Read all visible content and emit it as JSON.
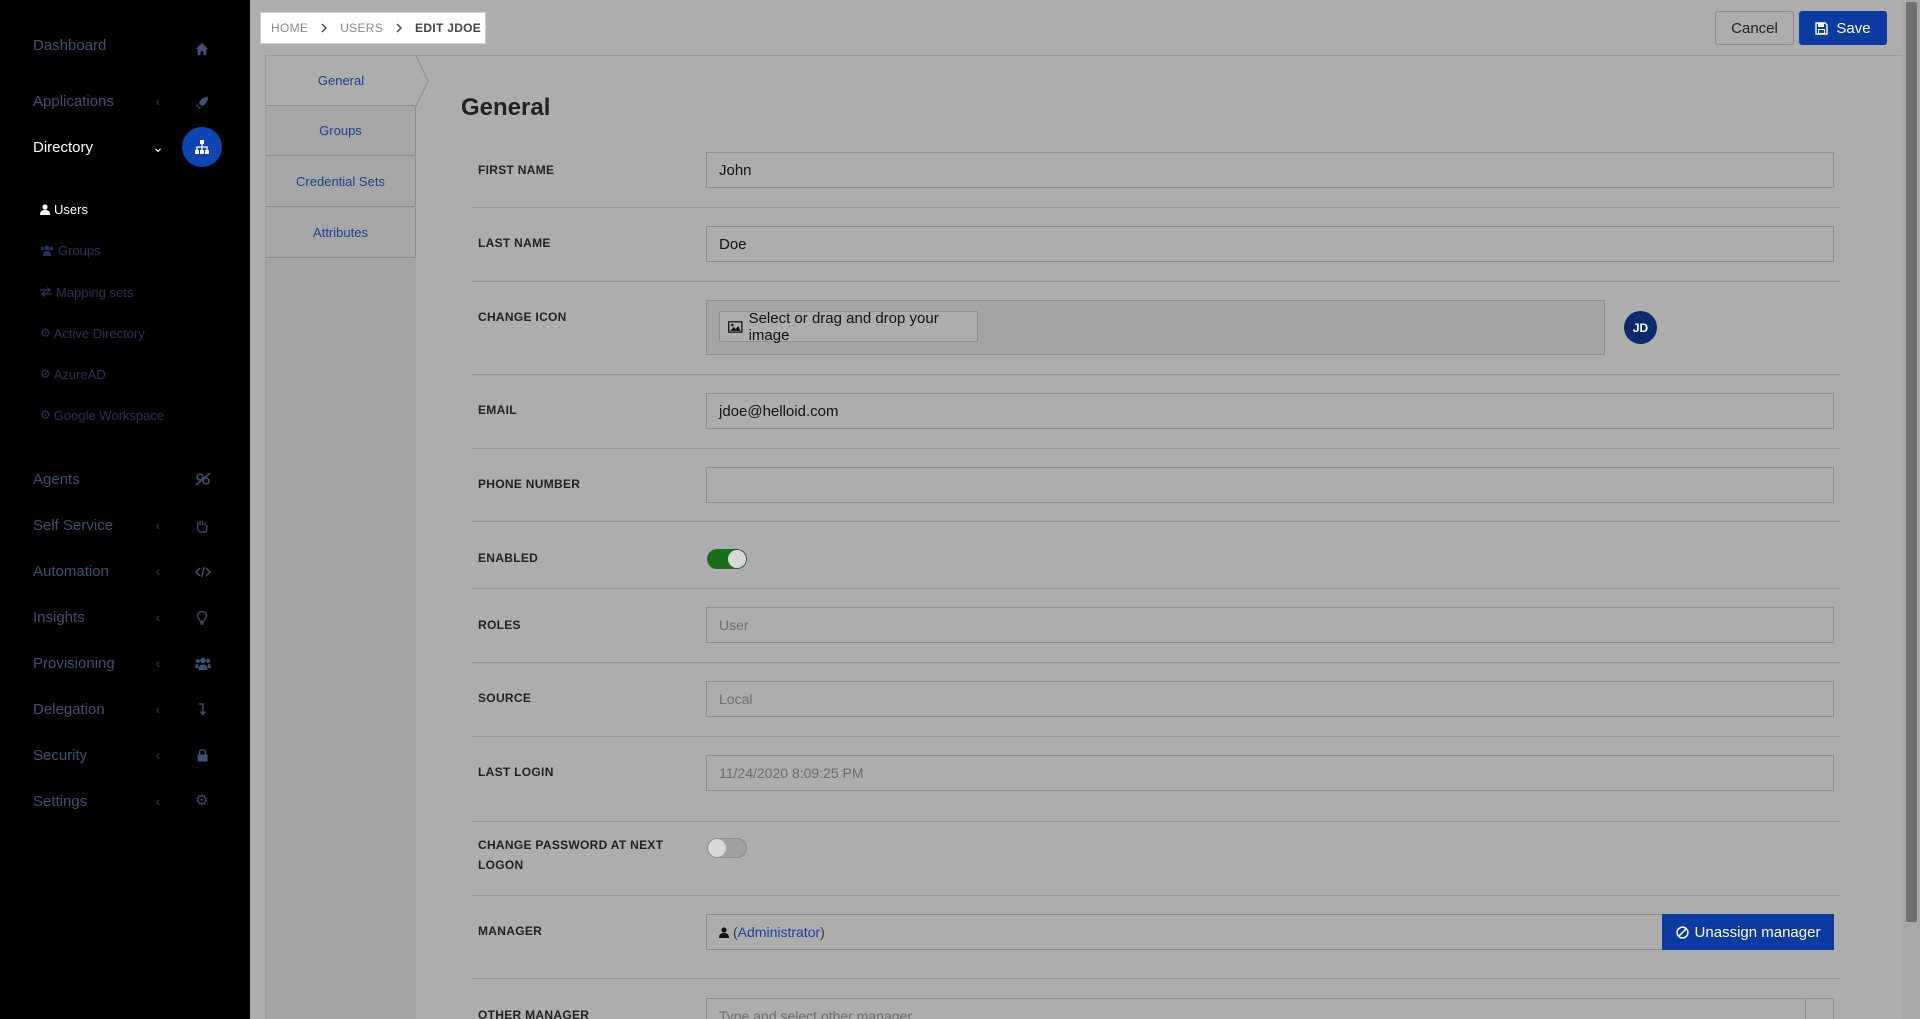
{
  "sidebar": {
    "items": [
      {
        "label": "Dashboard",
        "icon": "home-icon"
      },
      {
        "label": "Applications",
        "icon": "rocket-icon"
      },
      {
        "label": "Directory",
        "icon": "sitemap-icon"
      },
      {
        "label": "Agents",
        "icon": "agents-icon"
      },
      {
        "label": "Self Service",
        "icon": "hand-icon"
      },
      {
        "label": "Automation",
        "icon": "code-icon"
      },
      {
        "label": "Insights",
        "icon": "lightbulb-icon"
      },
      {
        "label": "Provisioning",
        "icon": "users-icon"
      },
      {
        "label": "Delegation",
        "icon": "delegation-icon"
      },
      {
        "label": "Security",
        "icon": "lock-icon"
      },
      {
        "label": "Settings",
        "icon": "gear-icon"
      }
    ],
    "directory_sub": [
      {
        "label": "Users",
        "icon": "user-icon"
      },
      {
        "label": "Groups",
        "icon": "users-icon"
      },
      {
        "label": "Mapping sets",
        "icon": "exchange-icon"
      },
      {
        "label": "Active Directory",
        "icon": "gear-icon"
      },
      {
        "label": "AzureAD",
        "icon": "gear-icon"
      },
      {
        "label": "Google Workspace",
        "icon": "gear-icon"
      }
    ]
  },
  "breadcrumb": [
    "HOME",
    "USERS",
    "EDIT JDOE"
  ],
  "toolbar": {
    "cancel_label": "Cancel",
    "save_label": "Save"
  },
  "tabs": [
    "General",
    "Groups",
    "Credential Sets",
    "Attributes"
  ],
  "form": {
    "title": "General",
    "first_name": {
      "label": "FIRST NAME",
      "value": "John"
    },
    "last_name": {
      "label": "LAST NAME",
      "value": "Doe"
    },
    "change_icon": {
      "label": "CHANGE ICON",
      "button": "Select or drag and drop your image",
      "avatar": "JD"
    },
    "email": {
      "label": "EMAIL",
      "value": "jdoe@helloid.com"
    },
    "phone": {
      "label": "PHONE NUMBER",
      "value": ""
    },
    "enabled": {
      "label": "ENABLED",
      "on": true
    },
    "roles": {
      "label": "ROLES",
      "value": "User"
    },
    "source": {
      "label": "SOURCE",
      "value": "Local"
    },
    "last_login": {
      "label": "LAST LOGIN",
      "value": "11/24/2020 8:09:25 PM"
    },
    "change_password": {
      "label_line1": "CHANGE PASSWORD AT NEXT",
      "label_line2": "LOGON",
      "on": false
    },
    "manager": {
      "label": "MANAGER",
      "open_paren": "(",
      "value": "Administrator",
      "close_paren": ")",
      "unassign": "Unassign manager"
    },
    "other_manager": {
      "label": "OTHER MANAGER",
      "placeholder": "Type and select other manager"
    }
  },
  "colors": {
    "accent": "#0a3aa2",
    "sidebar_bg": "#000000",
    "toggle_on": "#1a6e1a"
  }
}
